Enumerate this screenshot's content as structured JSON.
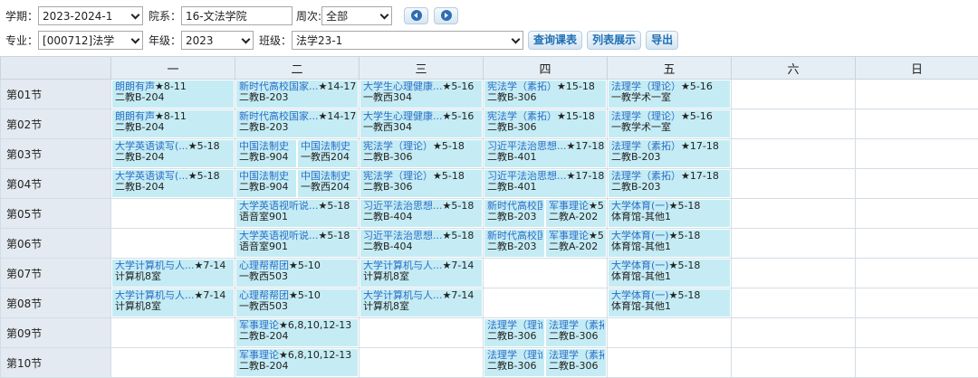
{
  "filters": {
    "xueqi_label": "学期：",
    "xueqi_value": "2023-2024-1",
    "yuanxi_label": "院系：",
    "yuanxi_value": "16-文法学院",
    "zhouci_label": "周次:",
    "zhouci_value": "全部",
    "zhuanye_label": "专业：",
    "zhuanye_value": "[000712]法学",
    "nianji_label": "年级：",
    "nianji_value": "2023",
    "banji_label": "班级：",
    "banji_value": "法学23-1",
    "query_button": "查询课表",
    "list_button": "列表展示",
    "export_button": "导出"
  },
  "days": [
    "一",
    "二",
    "三",
    "四",
    "五",
    "六",
    "日"
  ],
  "sections": [
    "第01节",
    "第02节",
    "第03节",
    "第04节",
    "第05节",
    "第06节",
    "第07节",
    "第08节",
    "第09节",
    "第10节"
  ],
  "schedule": [
    [
      [
        {
          "name": "朗朗有声",
          "weeks": "★8-11",
          "room": "二教B-204"
        }
      ],
      [
        {
          "name": "新时代高校国家...",
          "weeks": "★14-17",
          "room": "二教B-203"
        }
      ],
      [
        {
          "name": "大学生心理健康...",
          "weeks": "★5-16",
          "room": "一教西304"
        }
      ],
      [
        {
          "name": "宪法学（素拓）",
          "weeks": "★15-18",
          "room": "二教B-306"
        }
      ],
      [
        {
          "name": "法理学（理论）",
          "weeks": "★5-16",
          "room": "一教学术一室"
        }
      ],
      [],
      []
    ],
    [
      [
        {
          "name": "朗朗有声",
          "weeks": "★8-11",
          "room": "二教B-204"
        }
      ],
      [
        {
          "name": "新时代高校国家...",
          "weeks": "★14-17",
          "room": "二教B-203"
        }
      ],
      [
        {
          "name": "大学生心理健康...",
          "weeks": "★5-16",
          "room": "一教西304"
        }
      ],
      [
        {
          "name": "宪法学（素拓）",
          "weeks": "★15-18",
          "room": "二教B-306"
        }
      ],
      [
        {
          "name": "法理学（理论）",
          "weeks": "★5-16",
          "room": "一教学术一室"
        }
      ],
      [],
      []
    ],
    [
      [
        {
          "name": "大学英语读写(...",
          "weeks": "★5-18",
          "room": "二教B-204"
        }
      ],
      [
        {
          "name": "中国法制史",
          "weeks": "",
          "room": "二教B-904"
        },
        {
          "name": "中国法制史",
          "weeks": "",
          "room": "一教西204"
        }
      ],
      [
        {
          "name": "宪法学（理论）",
          "weeks": "★5-18",
          "room": "二教B-306"
        }
      ],
      [
        {
          "name": "习近平法治思想...",
          "weeks": "★17-18",
          "room": "二教B-401"
        }
      ],
      [
        {
          "name": "法理学（素拓）",
          "weeks": "★17-18",
          "room": "二教B-203"
        }
      ],
      [],
      []
    ],
    [
      [
        {
          "name": "大学英语读写(...",
          "weeks": "★5-18",
          "room": "二教B-204"
        }
      ],
      [
        {
          "name": "中国法制史",
          "weeks": "",
          "room": "二教B-904"
        },
        {
          "name": "中国法制史",
          "weeks": "",
          "room": "一教西204"
        }
      ],
      [
        {
          "name": "宪法学（理论）",
          "weeks": "★5-18",
          "room": "二教B-306"
        }
      ],
      [
        {
          "name": "习近平法治思想...",
          "weeks": "★17-18",
          "room": "二教B-401"
        }
      ],
      [
        {
          "name": "法理学（素拓）",
          "weeks": "★17-18",
          "room": "二教B-203"
        }
      ],
      [],
      []
    ],
    [
      [],
      [
        {
          "name": "大学英语视听说...",
          "weeks": "★5-18",
          "room": "语音室901"
        }
      ],
      [
        {
          "name": "习近平法治思想...",
          "weeks": "★5-18",
          "room": "二教B-404"
        }
      ],
      [
        {
          "name": "新时代高校国",
          "weeks": "",
          "room": "二教B-203"
        },
        {
          "name": "军事理论",
          "weeks": "★5",
          "room": "二教A-202"
        }
      ],
      [
        {
          "name": "大学体育(一)",
          "weeks": "★5-18",
          "room": "体育馆-其他1"
        }
      ],
      [],
      []
    ],
    [
      [],
      [
        {
          "name": "大学英语视听说...",
          "weeks": "★5-18",
          "room": "语音室901"
        }
      ],
      [
        {
          "name": "习近平法治思想...",
          "weeks": "★5-18",
          "room": "二教B-404"
        }
      ],
      [
        {
          "name": "新时代高校国",
          "weeks": "",
          "room": "二教B-203"
        },
        {
          "name": "军事理论",
          "weeks": "★5",
          "room": "二教A-202"
        }
      ],
      [
        {
          "name": "大学体育(一)",
          "weeks": "★5-18",
          "room": "体育馆-其他1"
        }
      ],
      [],
      []
    ],
    [
      [
        {
          "name": "大学计算机与人...",
          "weeks": "★7-14",
          "room": "计算机8室"
        }
      ],
      [
        {
          "name": "心理帮帮团",
          "weeks": "★5-10",
          "room": "一教西503"
        }
      ],
      [
        {
          "name": "大学计算机与人...",
          "weeks": "★7-14",
          "room": "计算机8室"
        }
      ],
      [],
      [
        {
          "name": "大学体育(一)",
          "weeks": "★5-18",
          "room": "体育馆-其他1"
        }
      ],
      [],
      []
    ],
    [
      [
        {
          "name": "大学计算机与人...",
          "weeks": "★7-14",
          "room": "计算机8室"
        }
      ],
      [
        {
          "name": "心理帮帮团",
          "weeks": "★5-10",
          "room": "一教西503"
        }
      ],
      [
        {
          "name": "大学计算机与人...",
          "weeks": "★7-14",
          "room": "计算机8室"
        }
      ],
      [],
      [
        {
          "name": "大学体育(一)",
          "weeks": "★5-18",
          "room": "体育馆-其他1"
        }
      ],
      [],
      []
    ],
    [
      [],
      [
        {
          "name": "军事理论",
          "weeks": "★6,8,10,12-13",
          "room": "二教B-204"
        }
      ],
      [],
      [
        {
          "name": "法理学（理论",
          "weeks": "",
          "room": "二教B-306"
        },
        {
          "name": "法理学（素拓",
          "weeks": "",
          "room": "二教B-306"
        }
      ],
      [],
      [],
      []
    ],
    [
      [],
      [
        {
          "name": "军事理论",
          "weeks": "★6,8,10,12-13",
          "room": "二教B-204"
        }
      ],
      [],
      [
        {
          "name": "法理学（理论",
          "weeks": "",
          "room": "二教B-306"
        },
        {
          "name": "法理学（素拓",
          "weeks": "",
          "room": "二教B-306"
        }
      ],
      [],
      [],
      []
    ]
  ]
}
